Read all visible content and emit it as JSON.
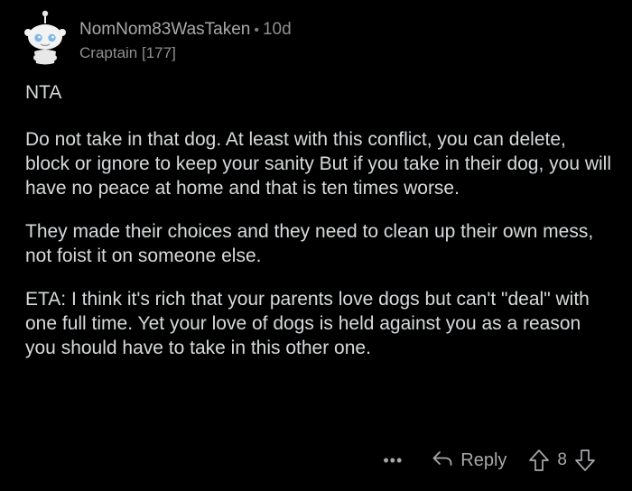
{
  "comment": {
    "username": "NomNom83WasTaken",
    "separator": "•",
    "age": "10d",
    "flair": "Craptain [177]",
    "avatar_icon": "snoo-avatar-icon",
    "paragraphs": [
      "NTA",
      "Do not take in that dog. At least with this conflict, you can delete, block or ignore to keep your sanity But if you take in their dog, you will have no peace at home and that is ten times worse.",
      "They made their choices and they need to clean up their own mess, not foist it on someone else.",
      "ETA: I think it's rich that your parents love dogs but can't \"deal\" with one full time. Yet your love of dogs is held against you as a reason you should have to take in this other one."
    ]
  },
  "actions": {
    "more_label": "•••",
    "reply_label": "Reply",
    "score": "8",
    "icons": [
      "reply-arrow-icon",
      "upvote-arrow-icon",
      "downvote-arrow-icon"
    ]
  },
  "colors": {
    "background": "#000000",
    "text": "#d7dadc",
    "muted": "#8d8f91"
  }
}
